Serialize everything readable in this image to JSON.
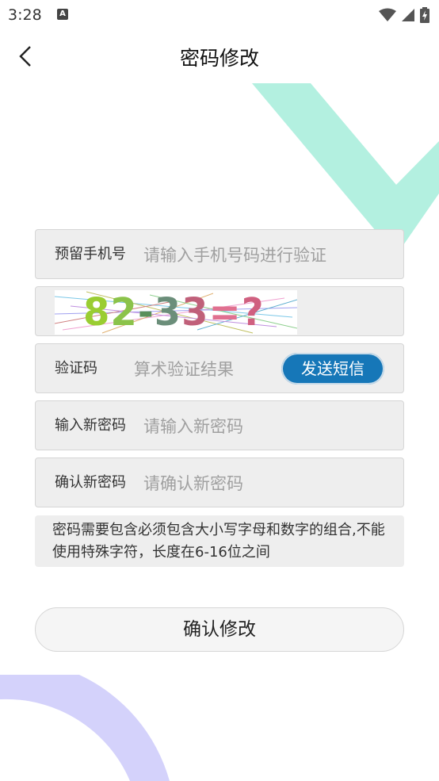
{
  "status": {
    "time": "3:28",
    "notification_icon": "A"
  },
  "header": {
    "title": "密码修改",
    "back_icon": "chevron-left-icon"
  },
  "form": {
    "phone": {
      "label": "预留手机号",
      "placeholder": "请输入手机号码进行验证"
    },
    "captcha": {
      "expression": "82-33=?"
    },
    "sms": {
      "label": "验证码",
      "placeholder": "算术验证结果",
      "send_label": "发送短信"
    },
    "new_password": {
      "label": "输入新密码",
      "placeholder": "请输入新密码"
    },
    "confirm_password": {
      "label": "确认新密码",
      "placeholder": "请确认新密码"
    }
  },
  "hint": "密码需要包含必须包含大小写字母和数字的组合,不能使用特殊字符，长度在6-16位之间",
  "submit_label": "确认修改",
  "colors": {
    "accent": "#1677b8",
    "deco_green": "#b3f0e0",
    "deco_purple": "#d4d2fb"
  }
}
